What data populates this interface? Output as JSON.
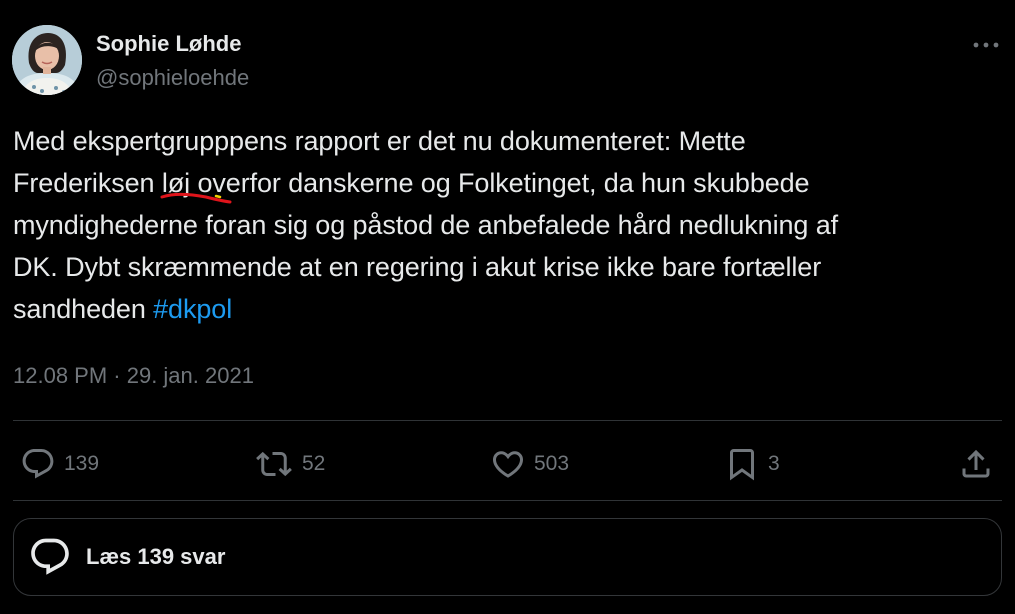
{
  "author": {
    "name": "Sophie Løhde",
    "handle": "@sophieloehde",
    "avatar_icon": "profile-photo"
  },
  "tweet": {
    "lines": [
      "Med ekspertgrupppens rapport er det nu dokumenteret: Mette",
      "myndighederne foran sig og påstod de anbefalede hård nedlukning af",
      "DK. Dybt skræmmende at en regering i akut krise ikke bare fortæller"
    ],
    "line2_before": "Frederiksen ",
    "line2_marked": "løj",
    "line2_after": " overfor danskerne og Folketinget, da hun skubbede",
    "line5_before": "sandheden ",
    "hashtag": "#dkpol",
    "timestamp": "12.08 PM · 29. jan. 2021"
  },
  "actions": {
    "replies": "139",
    "retweets": "52",
    "likes": "503",
    "bookmarks": "3"
  },
  "reply_bar": {
    "label": "Læs 139 svar"
  },
  "colors": {
    "background": "#000000",
    "text": "#e7e9ea",
    "muted": "#71767b",
    "link": "#1d9bf0",
    "markup_red": "#e0141b",
    "markup_yellow": "#f0d000"
  }
}
